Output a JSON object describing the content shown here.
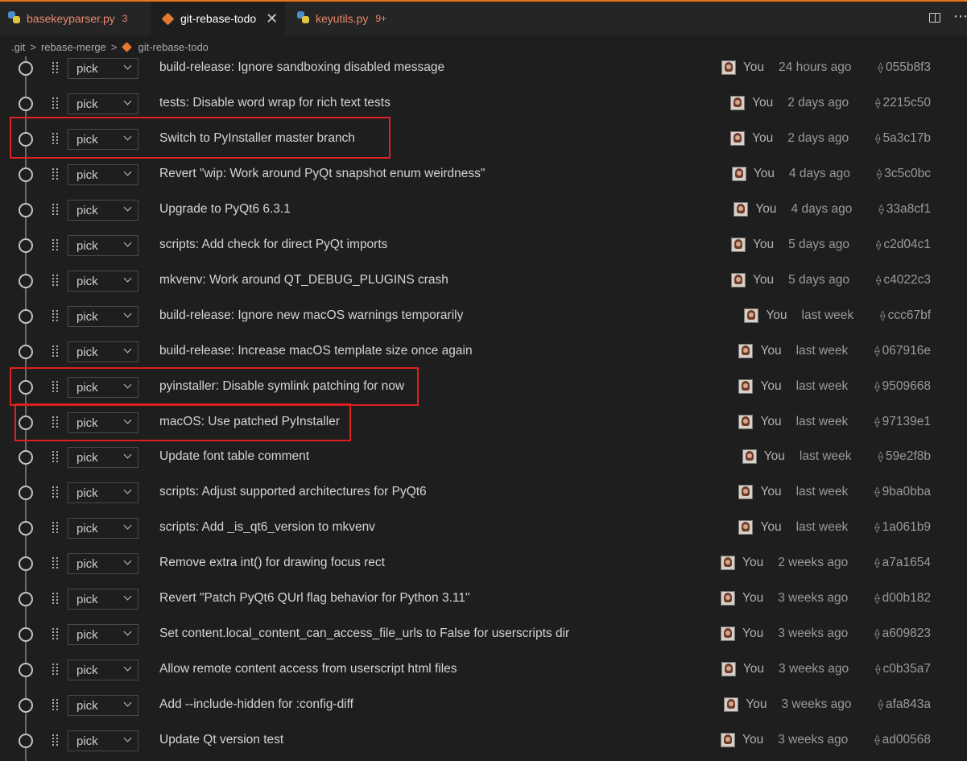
{
  "tabs": [
    {
      "label": "basekeyparser.py",
      "badge": "3",
      "icon": "python-icon",
      "label_color": "#e9886a",
      "badge_color": "#e9886a",
      "active": false
    },
    {
      "label": "git-rebase-todo",
      "badge": "",
      "icon": "git-icon",
      "label_color": "#ffffff",
      "badge_color": "",
      "active": true
    },
    {
      "label": "keyutils.py",
      "badge": "9+",
      "icon": "python-icon",
      "label_color": "#e9886a",
      "badge_color": "#e9886a",
      "active": false
    }
  ],
  "toolbar": {
    "split_icon": "split-editor-icon",
    "more_icon": "more-actions-icon",
    "close_glyph": "✕",
    "more_glyph": "⋯"
  },
  "breadcrumb": [
    ".git",
    "rebase-merge",
    "git-rebase-todo"
  ],
  "breadcrumb_sep": ">",
  "accent_color": "#e8741c",
  "highlight_color": "#e01f1f",
  "commit_glyph": "⟠",
  "commits": [
    {
      "action": "pick",
      "message": "build-release: Ignore sandboxing disabled message",
      "author": "You",
      "date": "24 hours ago",
      "hash": "055b8f3"
    },
    {
      "action": "pick",
      "message": "tests: Disable word wrap for rich text tests",
      "author": "You",
      "date": "2 days ago",
      "hash": "2215c50"
    },
    {
      "action": "pick",
      "message": "Switch to PyInstaller master branch",
      "author": "You",
      "date": "2 days ago",
      "hash": "5a3c17b"
    },
    {
      "action": "pick",
      "message": "Revert \"wip: Work around PyQt snapshot enum weirdness\"",
      "author": "You",
      "date": "4 days ago",
      "hash": "3c5c0bc"
    },
    {
      "action": "pick",
      "message": "Upgrade to PyQt6 6.3.1",
      "author": "You",
      "date": "4 days ago",
      "hash": "33a8cf1"
    },
    {
      "action": "pick",
      "message": "scripts: Add check for direct PyQt imports",
      "author": "You",
      "date": "5 days ago",
      "hash": "c2d04c1"
    },
    {
      "action": "pick",
      "message": "mkvenv: Work around QT_DEBUG_PLUGINS crash",
      "author": "You",
      "date": "5 days ago",
      "hash": "c4022c3"
    },
    {
      "action": "pick",
      "message": "build-release: Ignore new macOS warnings temporarily",
      "author": "You",
      "date": "last week",
      "hash": "ccc67bf"
    },
    {
      "action": "pick",
      "message": "build-release: Increase macOS template size once again",
      "author": "You",
      "date": "last week",
      "hash": "067916e"
    },
    {
      "action": "pick",
      "message": "pyinstaller: Disable symlink patching for now",
      "author": "You",
      "date": "last week",
      "hash": "9509668"
    },
    {
      "action": "pick",
      "message": "macOS: Use patched PyInstaller",
      "author": "You",
      "date": "last week",
      "hash": "97139e1"
    },
    {
      "action": "pick",
      "message": "Update font table comment",
      "author": "You",
      "date": "last week",
      "hash": "59e2f8b"
    },
    {
      "action": "pick",
      "message": "scripts: Adjust supported architectures for PyQt6",
      "author": "You",
      "date": "last week",
      "hash": "9ba0bba"
    },
    {
      "action": "pick",
      "message": "scripts: Add _is_qt6_version to mkvenv",
      "author": "You",
      "date": "last week",
      "hash": "1a061b9"
    },
    {
      "action": "pick",
      "message": "Remove extra int() for drawing focus rect",
      "author": "You",
      "date": "2 weeks ago",
      "hash": "a7a1654"
    },
    {
      "action": "pick",
      "message": "Revert \"Patch PyQt6 QUrl flag behavior for Python 3.11\"",
      "author": "You",
      "date": "3 weeks ago",
      "hash": "d00b182"
    },
    {
      "action": "pick",
      "message": "Set content.local_content_can_access_file_urls to False for userscripts dir",
      "author": "You",
      "date": "3 weeks ago",
      "hash": "a609823"
    },
    {
      "action": "pick",
      "message": "Allow remote content access from userscript html files",
      "author": "You",
      "date": "3 weeks ago",
      "hash": "c0b35a7"
    },
    {
      "action": "pick",
      "message": "Add --include-hidden for :config-diff",
      "author": "You",
      "date": "3 weeks ago",
      "hash": "afa843a"
    },
    {
      "action": "pick",
      "message": "Update Qt version test",
      "author": "You",
      "date": "3 weeks ago",
      "hash": "ad00568"
    }
  ]
}
